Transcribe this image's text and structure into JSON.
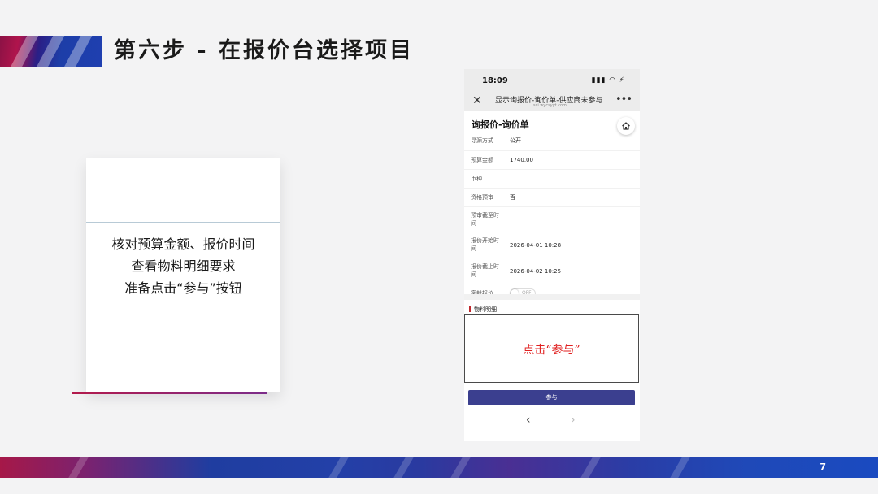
{
  "slide": {
    "title": "第六步 - 在报价台选择项目",
    "page_number": "7"
  },
  "card": {
    "lines": [
      "核对预算金额、报价时间",
      "查看物料明细要求",
      "准备点击“参与”按钮"
    ]
  },
  "phone": {
    "status": {
      "time": "18:09",
      "icons": "▮▮▮ ◠ ⚡"
    },
    "nav": {
      "title": "显示询报价-询价单-供应商未参与",
      "url": "sci.wycsyyt.com"
    },
    "page_title": "询报价-询价单",
    "fields": [
      {
        "label": "寻源方式",
        "value": "公开"
      },
      {
        "label": "预算金额",
        "value": "1740.00"
      },
      {
        "label": "币种",
        "value": ""
      },
      {
        "label": "资格预审",
        "value": "否"
      },
      {
        "label": "预审截至时间",
        "value": ""
      },
      {
        "label": "报价开始时间",
        "value": "2026-04-01 10:28"
      },
      {
        "label": "报价截止时间",
        "value": "2026-04-02 10:25"
      },
      {
        "label": "密封报价",
        "value": "OFF",
        "toggle": true,
        "on": false
      }
    ],
    "section_label": "物料明细",
    "highlight_text": "点击“参与”",
    "submit_label": "参与"
  },
  "colors": {
    "accent": "#3b3f8f",
    "highlight": "#e02020",
    "section_mark": "#c0282d"
  }
}
